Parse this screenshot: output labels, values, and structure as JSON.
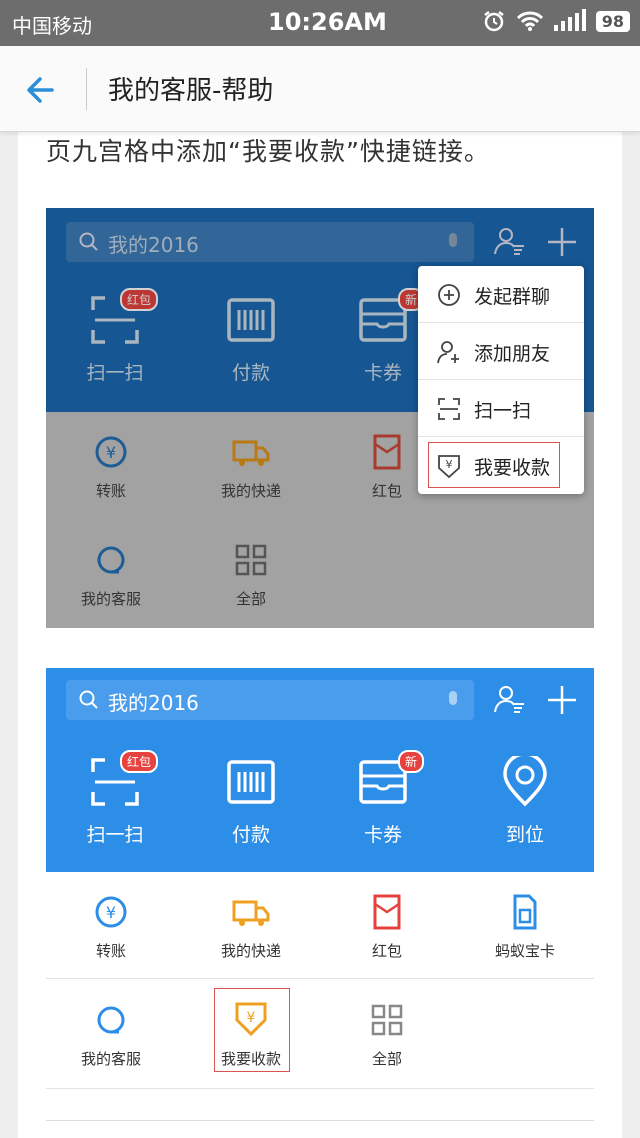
{
  "status_bar": {
    "carrier": "中国移动",
    "time": "10:26AM",
    "battery": "98"
  },
  "nav": {
    "title": "我的客服-帮助"
  },
  "intro_text": "页九宫格中添加“我要收款”快捷链接。",
  "shot1": {
    "search_text": "我的2016",
    "features": [
      {
        "label": "扫一扫",
        "badge": "红包"
      },
      {
        "label": "付款"
      },
      {
        "label": "卡券",
        "badge": "新"
      }
    ],
    "grid": [
      "转账",
      "我的快递",
      "红包",
      "我的客服",
      "全部"
    ],
    "menu": [
      "发起群聊",
      "添加朋友",
      "扫一扫",
      "我要收款"
    ]
  },
  "shot2": {
    "search_text": "我的2016",
    "features": [
      {
        "label": "扫一扫",
        "badge": "红包"
      },
      {
        "label": "付款"
      },
      {
        "label": "卡券",
        "badge": "新"
      },
      {
        "label": "到位"
      }
    ],
    "grid": [
      "转账",
      "我的快递",
      "红包",
      "蚂蚁宝卡",
      "我的客服",
      "我要收款",
      "全部"
    ]
  },
  "colors": {
    "status_bar": "#6d6d6d",
    "blue_dark": "#1c6ab4",
    "blue_light": "#2d8ee8",
    "overlay_grey": "#a2a2a2",
    "highlight_red": "#d9534f",
    "orange": "#f0a020"
  }
}
